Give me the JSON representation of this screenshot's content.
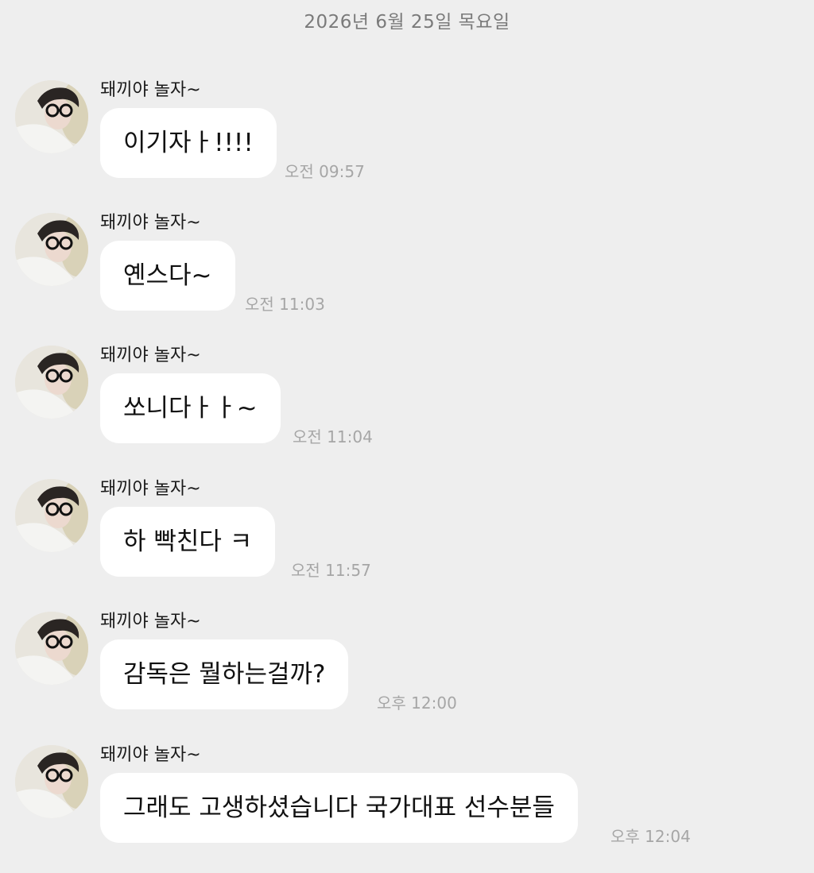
{
  "date_divider": "2026년 6월 25일 목요일",
  "messages": [
    {
      "sender": "돼끼야 놀자~",
      "text": "이기자ㅏ!!!!",
      "time": "오전 09:57"
    },
    {
      "sender": "돼끼야 놀자~",
      "text": "옌스다~",
      "time": "오전 11:03"
    },
    {
      "sender": "돼끼야 놀자~",
      "text": "쏘니다ㅏㅏ~",
      "time": "오전 11:04"
    },
    {
      "sender": "돼끼야 놀자~",
      "text": "하 빡친다 ㅋ",
      "time": "오전 11:57"
    },
    {
      "sender": "돼끼야 놀자~",
      "text": "감독은 뭘하는걸까?",
      "time": "오후 12:00"
    },
    {
      "sender": "돼끼야 놀자~",
      "text": "그래도 고생하셨습니다 국가대표 선수분들",
      "time": "오후 12:04"
    }
  ],
  "colors": {
    "background": "#eeeeee",
    "bubble": "#ffffff",
    "time_text": "#a6a6a6",
    "date_text": "#7a7a7a"
  },
  "icons": {
    "avatar": "profile-photo-avatar"
  }
}
